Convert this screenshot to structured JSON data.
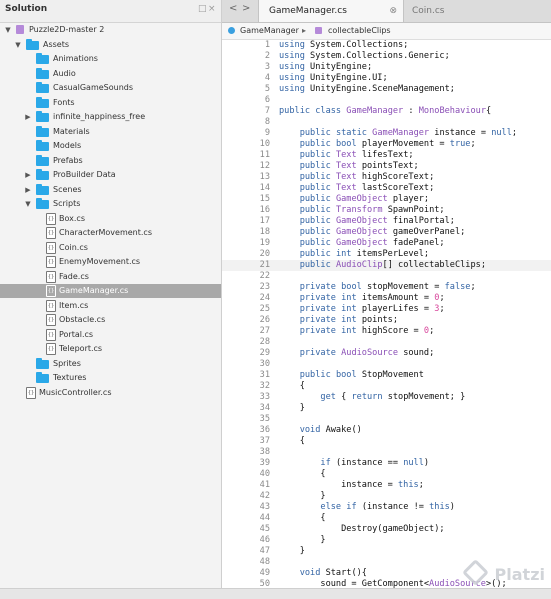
{
  "sidebar": {
    "title": "Solution",
    "header_buttons": [
      "□",
      "×"
    ],
    "tree": [
      {
        "label": "Puzzle2D-master 2",
        "depth": 0,
        "kind": "solution",
        "expand": "open"
      },
      {
        "label": "Assets",
        "depth": 1,
        "kind": "folder",
        "expand": "open"
      },
      {
        "label": "Animations",
        "depth": 2,
        "kind": "folder",
        "expand": "none"
      },
      {
        "label": "Audio",
        "depth": 2,
        "kind": "folder",
        "expand": "none"
      },
      {
        "label": "CasualGameSounds",
        "depth": 2,
        "kind": "folder",
        "expand": "none"
      },
      {
        "label": "Fonts",
        "depth": 2,
        "kind": "folder",
        "expand": "none"
      },
      {
        "label": "infinite_happiness_free",
        "depth": 2,
        "kind": "folder",
        "expand": "closed"
      },
      {
        "label": "Materials",
        "depth": 2,
        "kind": "folder",
        "expand": "none"
      },
      {
        "label": "Models",
        "depth": 2,
        "kind": "folder",
        "expand": "none"
      },
      {
        "label": "Prefabs",
        "depth": 2,
        "kind": "folder",
        "expand": "none"
      },
      {
        "label": "ProBuilder Data",
        "depth": 2,
        "kind": "folder",
        "expand": "closed"
      },
      {
        "label": "Scenes",
        "depth": 2,
        "kind": "folder",
        "expand": "closed"
      },
      {
        "label": "Scripts",
        "depth": 2,
        "kind": "folder",
        "expand": "open"
      },
      {
        "label": "Box.cs",
        "depth": 3,
        "kind": "file",
        "expand": "none"
      },
      {
        "label": "CharacterMovement.cs",
        "depth": 3,
        "kind": "file",
        "expand": "none"
      },
      {
        "label": "Coin.cs",
        "depth": 3,
        "kind": "file",
        "expand": "none"
      },
      {
        "label": "EnemyMovement.cs",
        "depth": 3,
        "kind": "file",
        "expand": "none"
      },
      {
        "label": "Fade.cs",
        "depth": 3,
        "kind": "file",
        "expand": "none"
      },
      {
        "label": "GameManager.cs",
        "depth": 3,
        "kind": "file",
        "expand": "none",
        "selected": true
      },
      {
        "label": "Item.cs",
        "depth": 3,
        "kind": "file",
        "expand": "none"
      },
      {
        "label": "Obstacle.cs",
        "depth": 3,
        "kind": "file",
        "expand": "none"
      },
      {
        "label": "Portal.cs",
        "depth": 3,
        "kind": "file",
        "expand": "none"
      },
      {
        "label": "Teleport.cs",
        "depth": 3,
        "kind": "file",
        "expand": "none"
      },
      {
        "label": "Sprites",
        "depth": 2,
        "kind": "folder",
        "expand": "none"
      },
      {
        "label": "Textures",
        "depth": 2,
        "kind": "folder",
        "expand": "none"
      },
      {
        "label": "MusicController.cs",
        "depth": 1,
        "kind": "file",
        "expand": "none"
      }
    ]
  },
  "tabs": [
    {
      "label": "GameManager.cs",
      "active": true
    },
    {
      "label": "Coin.cs",
      "active": false
    }
  ],
  "tab_close_glyph": "⊗",
  "nav": {
    "back": "<",
    "forward": ">"
  },
  "breadcrumb": {
    "class_name": "GameManager",
    "separator": "▸",
    "member_name": "collectableClips"
  },
  "editor": {
    "current_line": 21,
    "lines": [
      {
        "n": "1",
        "code": "using System.Collections;"
      },
      {
        "n": "2",
        "code": "using System.Collections.Generic;"
      },
      {
        "n": "3",
        "code": "using UnityEngine;"
      },
      {
        "n": "4",
        "code": "using UnityEngine.UI;"
      },
      {
        "n": "5",
        "code": "using UnityEngine.SceneManagement;"
      },
      {
        "n": "6",
        "code": ""
      },
      {
        "n": "7",
        "code": "public class GameManager : MonoBehaviour{"
      },
      {
        "n": "8",
        "code": ""
      },
      {
        "n": "9",
        "code": "    public static GameManager instance = null;"
      },
      {
        "n": "10",
        "code": "    public bool playerMovement = true;"
      },
      {
        "n": "11",
        "code": "    public Text lifesText;"
      },
      {
        "n": "12",
        "code": "    public Text pointsText;"
      },
      {
        "n": "13",
        "code": "    public Text highScoreText;"
      },
      {
        "n": "14",
        "code": "    public Text lastScoreText;"
      },
      {
        "n": "15",
        "code": "    public GameObject player;"
      },
      {
        "n": "16",
        "code": "    public Transform SpawnPoint;"
      },
      {
        "n": "17",
        "code": "    public GameObject finalPortal;"
      },
      {
        "n": "18",
        "code": "    public GameObject gameOverPanel;"
      },
      {
        "n": "19",
        "code": "    public GameObject fadePanel;"
      },
      {
        "n": "20",
        "code": "    public int itemsPerLevel;"
      },
      {
        "n": "21",
        "code": "    public AudioClip[] collectableClips;"
      },
      {
        "n": "22",
        "code": ""
      },
      {
        "n": "23",
        "code": "    private bool stopMovement = false;"
      },
      {
        "n": "24",
        "code": "    private int itemsAmount = 0;"
      },
      {
        "n": "25",
        "code": "    private int playerLifes = 3;"
      },
      {
        "n": "26",
        "code": "    private int points;"
      },
      {
        "n": "27",
        "code": "    private int highScore = 0;"
      },
      {
        "n": "28",
        "code": ""
      },
      {
        "n": "29",
        "code": "    private AudioSource sound;"
      },
      {
        "n": "30",
        "code": ""
      },
      {
        "n": "31",
        "code": "    public bool StopMovement"
      },
      {
        "n": "32",
        "code": "    {"
      },
      {
        "n": "33",
        "code": "        get { return stopMovement; }"
      },
      {
        "n": "34",
        "code": "    }"
      },
      {
        "n": "35",
        "code": ""
      },
      {
        "n": "36",
        "code": "    void Awake()"
      },
      {
        "n": "37",
        "code": "    {"
      },
      {
        "n": "38",
        "code": ""
      },
      {
        "n": "39",
        "code": "        if (instance == null)"
      },
      {
        "n": "40",
        "code": "        {"
      },
      {
        "n": "41",
        "code": "            instance = this;"
      },
      {
        "n": "42",
        "code": "        }"
      },
      {
        "n": "43",
        "code": "        else if (instance != this)"
      },
      {
        "n": "44",
        "code": "        {"
      },
      {
        "n": "45",
        "code": "            Destroy(gameObject);"
      },
      {
        "n": "46",
        "code": "        }"
      },
      {
        "n": "47",
        "code": "    }"
      },
      {
        "n": "48",
        "code": ""
      },
      {
        "n": "49",
        "code": "    void Start(){"
      },
      {
        "n": "50",
        "code": "        sound = GetComponent<AudioSource>();"
      }
    ]
  },
  "watermark": "Platzi",
  "colors": {
    "keyword": "#3364a4",
    "class": "#8a4fb6",
    "number": "#d8479c",
    "folder": "#2aa8e8",
    "selection": "#a8a8a8"
  }
}
